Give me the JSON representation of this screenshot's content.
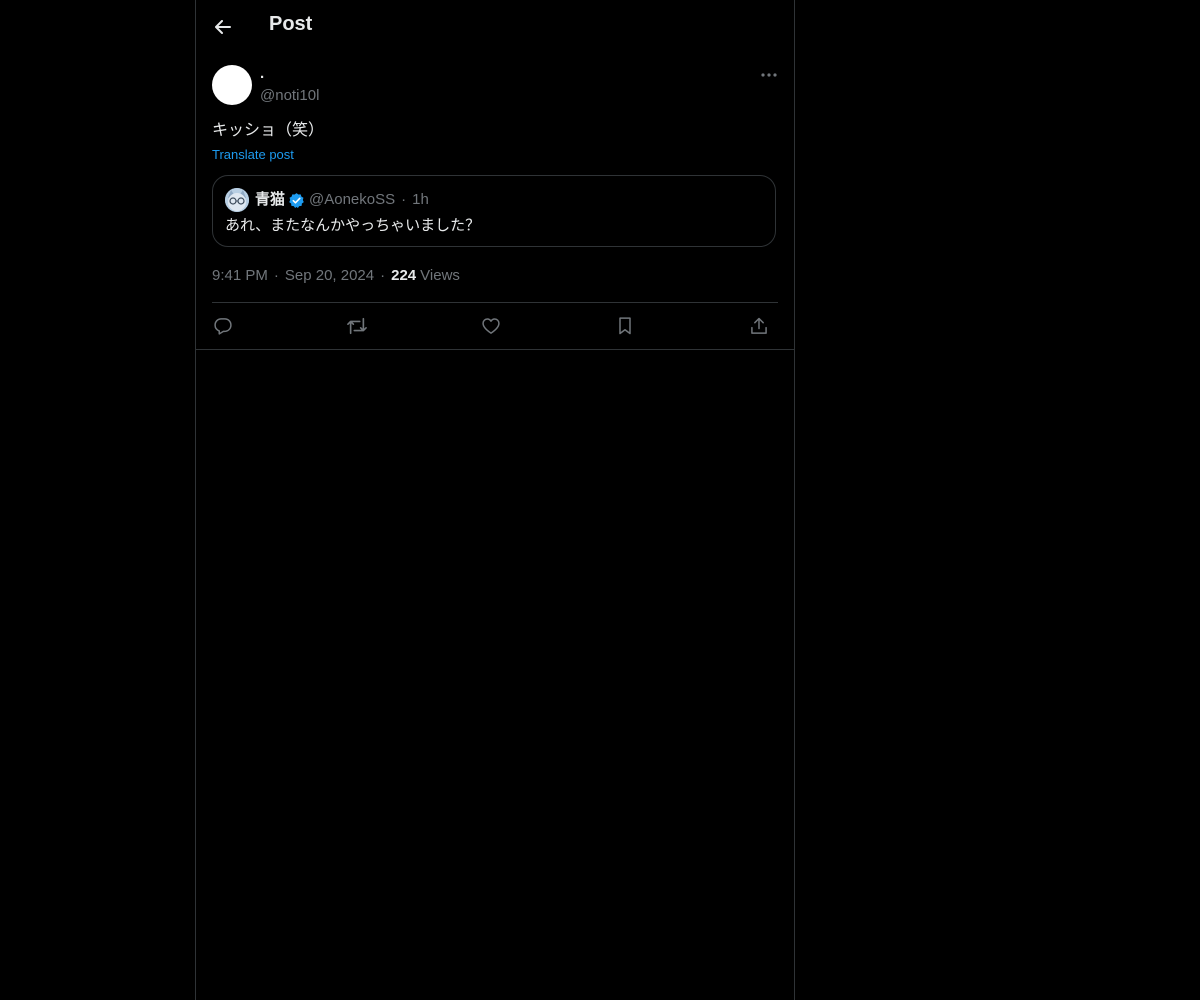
{
  "header": {
    "title": "Post"
  },
  "post": {
    "display_name": ".",
    "handle": "@noti10l",
    "text": "キッショ（笑）",
    "translate_label": "Translate post",
    "time": "9:41 PM",
    "date": "Sep 20, 2024",
    "separator": "·",
    "views_count": "224",
    "views_label": "Views"
  },
  "quote": {
    "name": "青猫",
    "handle": "@AonekoSS",
    "separator": "·",
    "time": "1h",
    "text": "あれ、またなんかやっちゃいました？"
  },
  "actions": [
    "reply-icon",
    "retweet-icon",
    "like-icon",
    "bookmark-icon",
    "share-icon"
  ],
  "colors": {
    "background": "#000000",
    "text": "#e7e9ea",
    "muted": "#71767b",
    "accent": "#1d9bf0",
    "border": "#2f3336"
  }
}
